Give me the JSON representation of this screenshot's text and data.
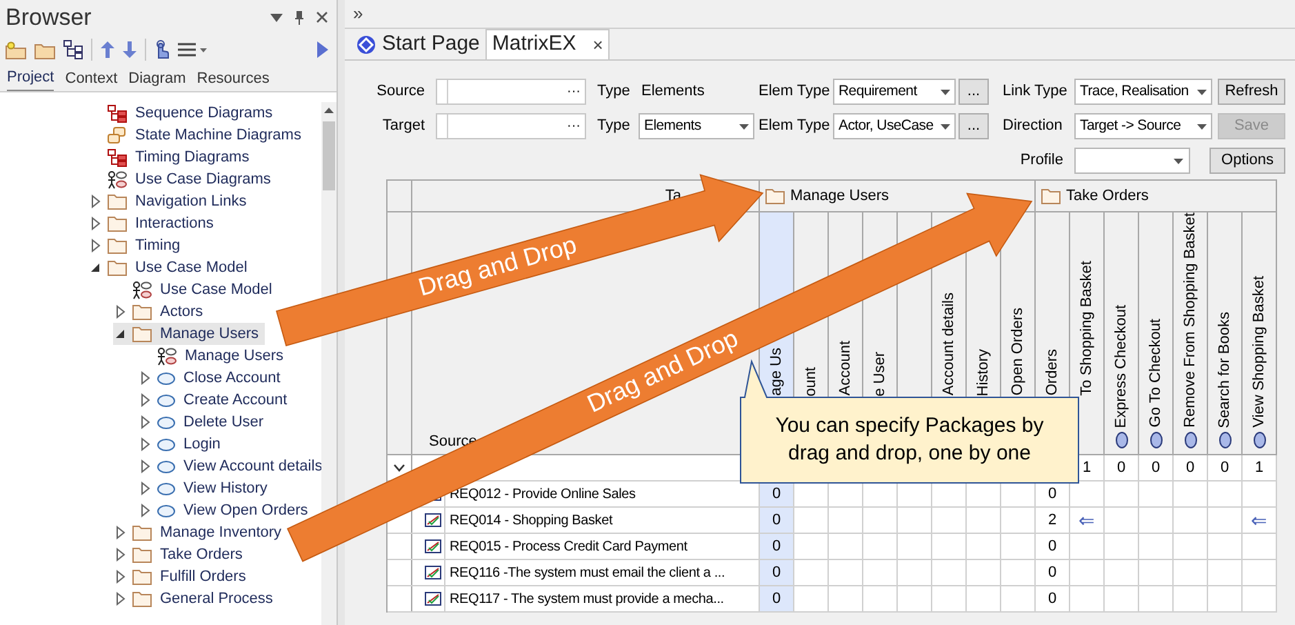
{
  "browser": {
    "title": "Browser",
    "tabs": [
      {
        "label": "Project",
        "selected": true
      },
      {
        "label": "Context",
        "selected": false
      },
      {
        "label": "Diagram",
        "selected": false
      },
      {
        "label": "Resources",
        "selected": false
      }
    ],
    "tree": [
      {
        "label": "Sequence Diagrams",
        "kind": "diagram",
        "selected": false
      },
      {
        "label": "State Machine Diagrams",
        "kind": "statemachine",
        "selected": false
      },
      {
        "label": "Timing Diagrams",
        "kind": "diagram",
        "selected": false
      },
      {
        "label": "Use Case Diagrams",
        "kind": "usecase-diagram",
        "selected": false
      },
      {
        "label": "Navigation Links",
        "kind": "folder",
        "expanded": false,
        "selected": false
      },
      {
        "label": "Interactions",
        "kind": "folder",
        "expanded": false,
        "selected": false
      },
      {
        "label": "Timing",
        "kind": "folder",
        "expanded": false,
        "selected": false
      },
      {
        "label": "Use Case Model",
        "kind": "folder",
        "expanded": true,
        "selected": false,
        "children": [
          {
            "label": "Use Case Model",
            "kind": "usecase-diagram",
            "selected": false
          },
          {
            "label": "Actors",
            "kind": "folder",
            "expanded": false,
            "selected": false
          },
          {
            "label": "Manage Users",
            "kind": "folder",
            "expanded": true,
            "selected": true,
            "children": [
              {
                "label": "Manage Users",
                "kind": "usecase-diagram",
                "selected": false
              },
              {
                "label": "Close Account",
                "kind": "usecase",
                "expanded": false,
                "selected": false
              },
              {
                "label": "Create Account",
                "kind": "usecase",
                "expanded": false,
                "selected": false
              },
              {
                "label": "Delete User",
                "kind": "usecase",
                "expanded": false,
                "selected": false
              },
              {
                "label": "Login",
                "kind": "usecase",
                "expanded": false,
                "selected": false
              },
              {
                "label": "View Account details",
                "kind": "usecase",
                "expanded": false,
                "selected": false
              },
              {
                "label": "View History",
                "kind": "usecase",
                "expanded": false,
                "selected": false
              },
              {
                "label": "View Open Orders",
                "kind": "usecase",
                "expanded": false,
                "selected": false
              }
            ]
          },
          {
            "label": "Manage Inventory",
            "kind": "folder",
            "expanded": false,
            "selected": false
          },
          {
            "label": "Take Orders",
            "kind": "folder",
            "expanded": false,
            "selected": false
          },
          {
            "label": "Fulfill Orders",
            "kind": "folder",
            "expanded": false,
            "selected": false
          },
          {
            "label": "General Process",
            "kind": "folder",
            "expanded": false,
            "selected": false
          }
        ]
      }
    ]
  },
  "overflow": "»",
  "doc_tabs": [
    {
      "label": "Start Page",
      "selected": false
    },
    {
      "label": "MatrixEX",
      "selected": true,
      "close": "×"
    }
  ],
  "form": {
    "rows": [
      {
        "label": "Source",
        "field_button": "···",
        "type_label": "Type",
        "type": {
          "kind": "text",
          "value": "Elements"
        },
        "elem_label": "Elem Type",
        "elem_value": "Requirement",
        "more": "...",
        "link_label": "Link Type",
        "link_value": "Trace, Realisation",
        "button": {
          "label": "Refresh",
          "disabled": false
        }
      },
      {
        "label": "Target",
        "field_button": "···",
        "type_label": "Type",
        "type": {
          "kind": "select",
          "value": "Elements"
        },
        "elem_label": "Elem Type",
        "elem_value": "Actor, UseCase",
        "more": "...",
        "link_label": "Direction",
        "link_value": "Target -> Source",
        "button": {
          "label": "Save",
          "disabled": true
        }
      }
    ],
    "profile": {
      "label": "Profile",
      "button": "Options"
    }
  },
  "matrix": {
    "corner_label": "Ta",
    "source_label": "Source",
    "groups": [
      {
        "label": "Manage Users",
        "columns": [
          {
            "label": "age Us",
            "kind": "partial",
            "selected": true
          },
          {
            "label": "ount",
            "kind": "partial",
            "selected": false
          },
          {
            "label": "Account",
            "kind": "partial",
            "selected": false
          },
          {
            "label": "e User",
            "kind": "partial",
            "selected": false
          },
          {
            "kind": "hidden"
          },
          {
            "label": "Account details",
            "kind": "partial",
            "selected": false
          },
          {
            "label": "History",
            "kind": "partial",
            "selected": false
          },
          {
            "label": "Open Orders",
            "kind": "partial",
            "selected": false
          }
        ]
      },
      {
        "label": "Take Orders",
        "columns": [
          {
            "label": "Orders",
            "kind": "partial",
            "selected": false
          },
          {
            "label": "To Shopping Basket",
            "kind": "partial",
            "selected": false
          },
          {
            "label": "Express Checkout",
            "kind": "full",
            "selected": false
          },
          {
            "label": "Go To Checkout",
            "kind": "full",
            "selected": false
          },
          {
            "label": "Remove From Shopping Basket",
            "kind": "full",
            "selected": false
          },
          {
            "label": "Search for Books",
            "kind": "full",
            "selected": false
          },
          {
            "label": "View Shopping Basket",
            "kind": "full",
            "selected": false
          }
        ]
      }
    ],
    "rows": [
      {
        "kind": "package",
        "expanded": true,
        "cells": [
          null,
          null,
          null,
          null,
          null,
          null,
          null,
          null,
          null,
          {
            "kind": "count",
            "value": "1"
          },
          {
            "kind": "count",
            "value": "0"
          },
          {
            "kind": "count",
            "value": "0"
          },
          {
            "kind": "count",
            "value": "0"
          },
          {
            "kind": "count",
            "value": "0"
          },
          {
            "kind": "count",
            "value": "1"
          }
        ]
      },
      {
        "kind": "requirement",
        "label": "REQ012 - Provide Online Sales",
        "cells": [
          {
            "kind": "count",
            "value": "0"
          },
          null,
          null,
          null,
          null,
          null,
          null,
          null,
          {
            "kind": "count",
            "value": "0"
          },
          null,
          null,
          null,
          null,
          null,
          null
        ]
      },
      {
        "kind": "requirement",
        "label": "REQ014 - Shopping Basket",
        "cells": [
          {
            "kind": "count",
            "value": "0"
          },
          null,
          null,
          null,
          null,
          null,
          null,
          null,
          {
            "kind": "count",
            "value": "2"
          },
          {
            "kind": "link",
            "value": "⇐"
          },
          null,
          null,
          null,
          null,
          {
            "kind": "link",
            "value": "⇐"
          }
        ]
      },
      {
        "kind": "requirement",
        "label": "REQ015 - Process Credit Card Payment",
        "cells": [
          {
            "kind": "count",
            "value": "0"
          },
          null,
          null,
          null,
          null,
          null,
          null,
          null,
          {
            "kind": "count",
            "value": "0"
          },
          null,
          null,
          null,
          null,
          null,
          null
        ]
      },
      {
        "kind": "requirement",
        "label": "REQ116 -The system must email the client a ...",
        "cells": [
          {
            "kind": "count",
            "value": "0"
          },
          null,
          null,
          null,
          null,
          null,
          null,
          null,
          {
            "kind": "count",
            "value": "0"
          },
          null,
          null,
          null,
          null,
          null,
          null
        ]
      },
      {
        "kind": "requirement",
        "label": "REQ117 - The system must provide a mecha...",
        "cells": [
          {
            "kind": "count",
            "value": "0"
          },
          null,
          null,
          null,
          null,
          null,
          null,
          null,
          {
            "kind": "count",
            "value": "0"
          },
          null,
          null,
          null,
          null,
          null,
          null
        ]
      }
    ]
  },
  "annotations": {
    "arrows": [
      {
        "label": "Drag and Drop"
      },
      {
        "label": "Drag and Drop"
      }
    ],
    "callout": "You can specify Packages by drag and drop, one by one"
  }
}
